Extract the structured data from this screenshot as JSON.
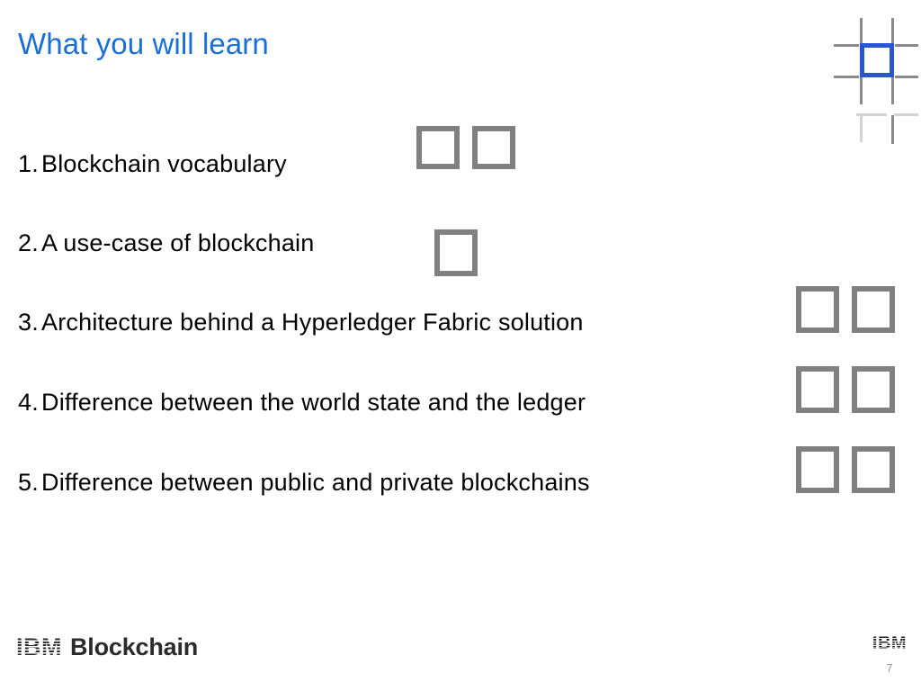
{
  "slide": {
    "title": "What you will learn",
    "title_color": "#1A6FD4",
    "background_color": "#ffffff",
    "number": "7"
  },
  "decoration": {
    "name": "grid-motif",
    "line_color": "#8a8a8a",
    "faint_line_color": "#d3d3d3",
    "accent_color": "#2A55D4"
  },
  "list": {
    "items": [
      {
        "number": "1.",
        "text": "Blockchain vocabulary",
        "glyph_boxes": 2
      },
      {
        "number": "2.",
        "text": "A use-case of blockchain",
        "glyph_boxes": 1
      },
      {
        "number": "3.",
        "text": "Architecture behind a Hyperledger Fabric solution",
        "glyph_boxes": 2
      },
      {
        "number": "4.",
        "text": "Difference between the world state and the ledger",
        "glyph_boxes": 2
      },
      {
        "number": "5.",
        "text": "Difference between public and private blockchains",
        "glyph_boxes": 2
      }
    ],
    "glyph_box_color": "#808080"
  },
  "footer": {
    "brand_prefix": "IBM",
    "brand_suffix": "Blockchain",
    "corner_mark": "IBM",
    "page_number": "7"
  }
}
